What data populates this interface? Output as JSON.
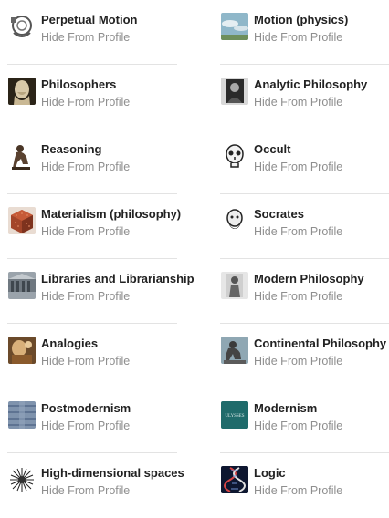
{
  "hide_label": "Hide From Profile",
  "left": [
    {
      "title": "Perpetual Motion",
      "icon": "perpetual-motion-icon"
    },
    {
      "title": "Philosophers",
      "icon": "philosopher-bust-icon"
    },
    {
      "title": "Reasoning",
      "icon": "thinker-statue-icon"
    },
    {
      "title": "Materialism (philosophy)",
      "icon": "bead-cube-icon"
    },
    {
      "title": "Libraries and Librarianship",
      "icon": "library-icon"
    },
    {
      "title": "Analogies",
      "icon": "painting-icon"
    },
    {
      "title": "Postmodernism",
      "icon": "blue-texture-icon"
    },
    {
      "title": "High-dimensional spaces",
      "icon": "starburst-icon"
    }
  ],
  "right": [
    {
      "title": "Motion (physics)",
      "icon": "sky-photo-icon"
    },
    {
      "title": "Analytic Philosophy",
      "icon": "portrait-icon"
    },
    {
      "title": "Occult",
      "icon": "skull-icon"
    },
    {
      "title": "Socrates",
      "icon": "socrates-icon"
    },
    {
      "title": "Modern Philosophy",
      "icon": "statue-icon"
    },
    {
      "title": "Continental Philosophy",
      "icon": "thinker-photo-icon"
    },
    {
      "title": "Modernism",
      "icon": "ulysses-book-icon"
    },
    {
      "title": "Logic",
      "icon": "dna-helix-icon"
    }
  ],
  "ulysses_text": "ULYSSES"
}
